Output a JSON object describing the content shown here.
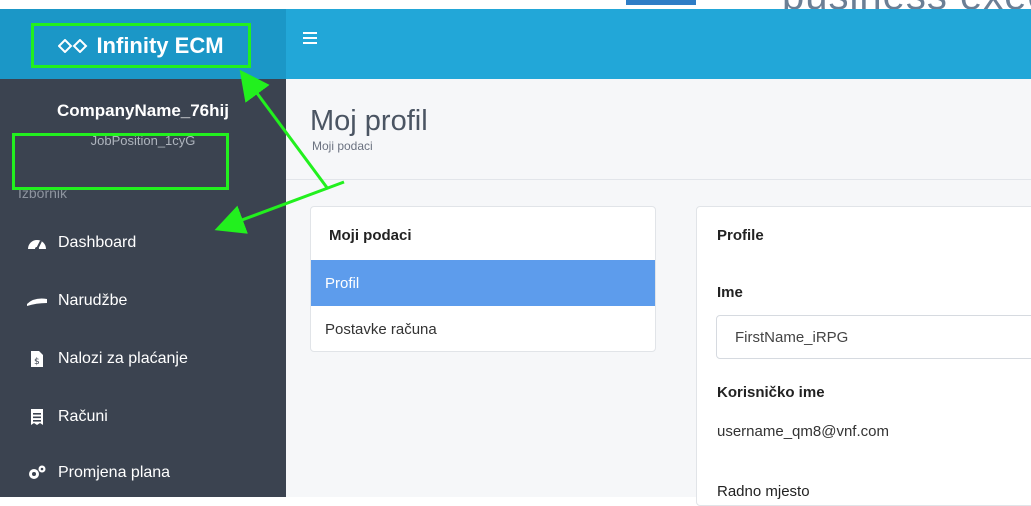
{
  "top_crop_text": "business exec",
  "brand": {
    "name": "Infinity ECM"
  },
  "sidebar": {
    "company": "CompanyName_76hij",
    "position": "JobPosition_1cyG",
    "section_label": "Izbornik",
    "items": [
      {
        "label": "Dashboard",
        "icon": "dashboard-icon"
      },
      {
        "label": "Narudžbe",
        "icon": "orders-icon"
      },
      {
        "label": "Nalozi za plaćanje",
        "icon": "payment-order-icon"
      },
      {
        "label": "Računi",
        "icon": "invoice-icon"
      },
      {
        "label": "Promjena plana",
        "icon": "cogs-icon"
      }
    ]
  },
  "header": {
    "title": "Moj profil",
    "subtitle": "Moji podaci"
  },
  "left_card": {
    "title": "Moji podaci",
    "items": [
      {
        "label": "Profil",
        "active": true
      },
      {
        "label": "Postavke računa",
        "active": false
      }
    ]
  },
  "right_card": {
    "title": "Profile",
    "name_label": "Ime",
    "name_value": "FirstName_iRPG",
    "username_label": "Korisničko ime",
    "username_value": "username_qm8@vnf.com",
    "job_label": "Radno mjesto"
  },
  "colors": {
    "navbar": "#22a7d8",
    "sidebar": "#3b4350",
    "active_item": "#5d9cec",
    "annotation": "#22f01e"
  }
}
